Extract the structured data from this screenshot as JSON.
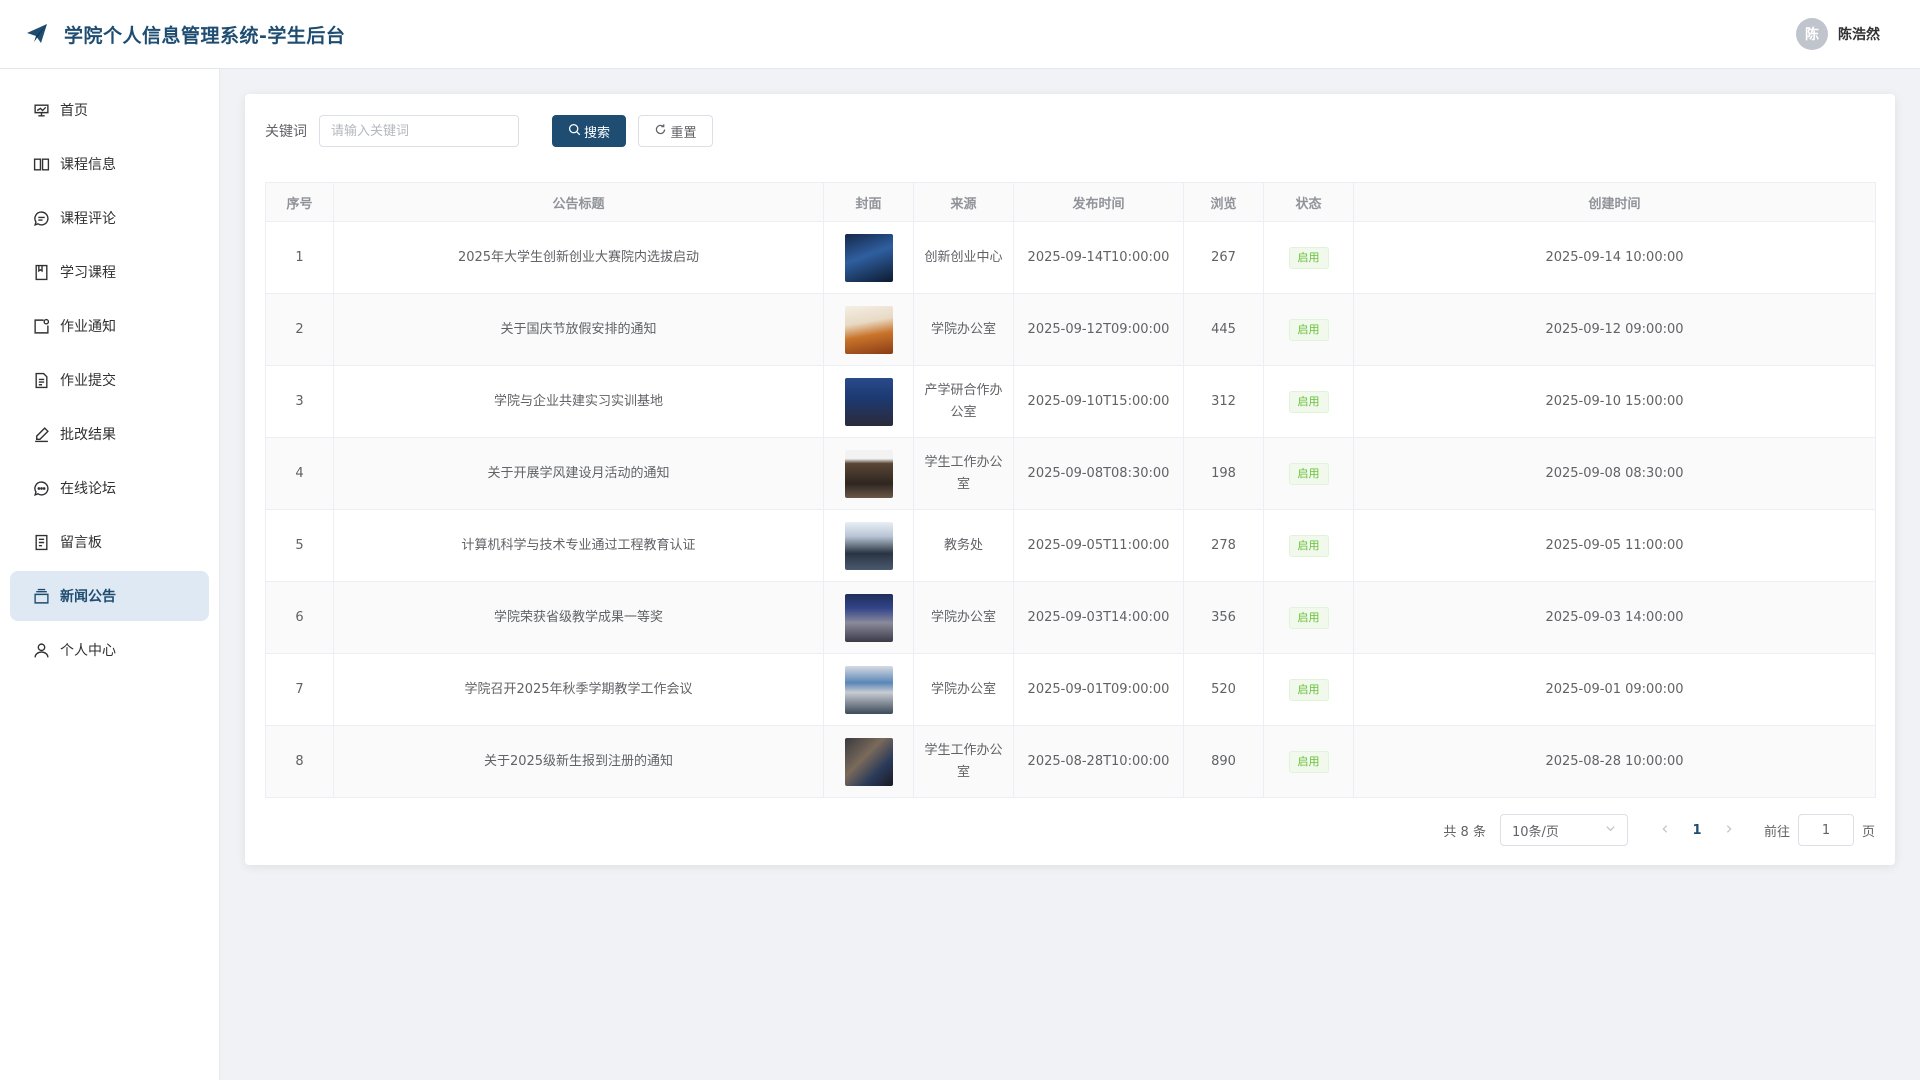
{
  "header": {
    "title": "学院个人信息管理系统-学生后台",
    "user": {
      "avatar_text": "陈",
      "name": "陈浩然"
    }
  },
  "sidebar": {
    "items": [
      {
        "label": "首页",
        "icon": "home-icon",
        "active": false
      },
      {
        "label": "课程信息",
        "icon": "book-icon",
        "active": false
      },
      {
        "label": "课程评论",
        "icon": "comment-icon",
        "active": false
      },
      {
        "label": "学习课程",
        "icon": "notebook-icon",
        "active": false
      },
      {
        "label": "作业通知",
        "icon": "notice-icon",
        "active": false
      },
      {
        "label": "作业提交",
        "icon": "document-icon",
        "active": false
      },
      {
        "label": "批改结果",
        "icon": "edit-pen-icon",
        "active": false
      },
      {
        "label": "在线论坛",
        "icon": "chat-dots-icon",
        "active": false
      },
      {
        "label": "留言板",
        "icon": "tickets-icon",
        "active": false
      },
      {
        "label": "新闻公告",
        "icon": "box-icon",
        "active": true
      },
      {
        "label": "个人中心",
        "icon": "user-icon",
        "active": false
      }
    ]
  },
  "search": {
    "keyword_label": "关键词",
    "placeholder": "请输入关键词",
    "value": "",
    "search_label": "搜索",
    "reset_label": "重置"
  },
  "table": {
    "columns": [
      "序号",
      "公告标题",
      "封面",
      "来源",
      "发布时间",
      "浏览",
      "状态",
      "创建时间"
    ],
    "rows": [
      {
        "index": "1",
        "title": "2025年大学生创新创业大赛院内选拔启动",
        "source": "创新创业中心",
        "publish_time": "2025-09-14T10:00:00",
        "views": "267",
        "status": "启用",
        "created": "2025-09-14 10:00:00"
      },
      {
        "index": "2",
        "title": "关于国庆节放假安排的通知",
        "source": "学院办公室",
        "publish_time": "2025-09-12T09:00:00",
        "views": "445",
        "status": "启用",
        "created": "2025-09-12 09:00:00"
      },
      {
        "index": "3",
        "title": "学院与企业共建实习实训基地",
        "source": "产学研合作办公室",
        "publish_time": "2025-09-10T15:00:00",
        "views": "312",
        "status": "启用",
        "created": "2025-09-10 15:00:00"
      },
      {
        "index": "4",
        "title": "关于开展学风建设月活动的通知",
        "source": "学生工作办公室",
        "publish_time": "2025-09-08T08:30:00",
        "views": "198",
        "status": "启用",
        "created": "2025-09-08 08:30:00"
      },
      {
        "index": "5",
        "title": "计算机科学与技术专业通过工程教育认证",
        "source": "教务处",
        "publish_time": "2025-09-05T11:00:00",
        "views": "278",
        "status": "启用",
        "created": "2025-09-05 11:00:00"
      },
      {
        "index": "6",
        "title": "学院荣获省级教学成果一等奖",
        "source": "学院办公室",
        "publish_time": "2025-09-03T14:00:00",
        "views": "356",
        "status": "启用",
        "created": "2025-09-03 14:00:00"
      },
      {
        "index": "7",
        "title": "学院召开2025年秋季学期教学工作会议",
        "source": "学院办公室",
        "publish_time": "2025-09-01T09:00:00",
        "views": "520",
        "status": "启用",
        "created": "2025-09-01 09:00:00"
      },
      {
        "index": "8",
        "title": "关于2025级新生报到注册的通知",
        "source": "学生工作办公室",
        "publish_time": "2025-08-28T10:00:00",
        "views": "890",
        "status": "启用",
        "created": "2025-08-28 10:00:00"
      }
    ]
  },
  "pagination": {
    "total_text": "共 8 条",
    "page_size": "10条/页",
    "current_page": "1",
    "goto_label": "前往",
    "goto_value": "1",
    "page_suffix": "页"
  },
  "colors": {
    "primary": "#1f4d72",
    "active_bg": "#dfe9f3",
    "status_green": "#67c23a"
  }
}
